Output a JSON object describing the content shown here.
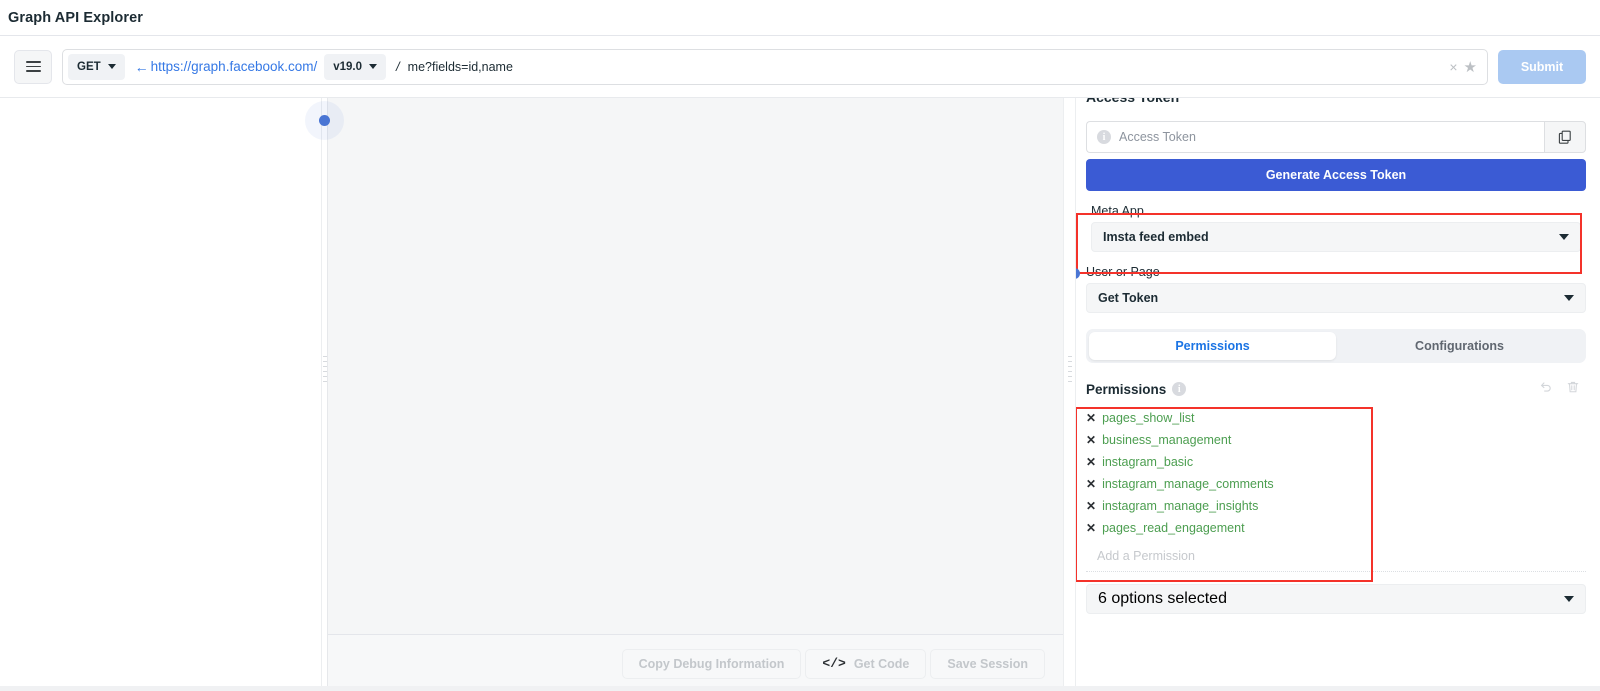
{
  "header": {
    "title": "Graph API Explorer"
  },
  "query_bar": {
    "menu_icon": "hamburger-icon",
    "method": "GET",
    "back_arrow": "←",
    "base_url": "https://graph.facebook.com/",
    "version": "v19.0",
    "separator": "/",
    "path_value": "me?fields=id,name",
    "path_placeholder": "me?fields=id,name",
    "clear_icon": "×",
    "star_icon": "★",
    "submit_label": "Submit"
  },
  "footer": {
    "copy_debug_label": "Copy Debug Information",
    "get_code_label": "Get Code",
    "get_code_icon": "</>",
    "save_session_label": "Save Session"
  },
  "right_panel": {
    "access_token_heading": "Access Token",
    "token_placeholder": "Access Token",
    "token_value": "",
    "info_icon": "i",
    "copy_icon": "copy-icon",
    "generate_label": "Generate Access Token",
    "meta_app_label": "Meta App",
    "meta_app_value": "Imsta feed embed",
    "user_or_page_label": "User or Page",
    "user_or_page_value": "Get Token",
    "tabs": [
      {
        "label": "Permissions",
        "active": true
      },
      {
        "label": "Configurations",
        "active": false
      }
    ],
    "permissions_title": "Permissions",
    "permissions_info_icon": "i",
    "undo_icon": "undo-icon",
    "trash_icon": "trash-icon",
    "permissions": [
      "pages_show_list",
      "business_management",
      "instagram_basic",
      "instagram_manage_comments",
      "instagram_manage_insights",
      "pages_read_engagement"
    ],
    "add_permission_placeholder": "Add a Permission",
    "options_selected_label": "6 options selected"
  },
  "colors": {
    "accent_blue": "#3b5bd4",
    "link_blue": "#3578e5",
    "tab_active_blue": "#1b74e4",
    "permission_green": "#4c9e50",
    "highlight_red": "#f4322a",
    "submit_disabled": "#aac9f2"
  }
}
